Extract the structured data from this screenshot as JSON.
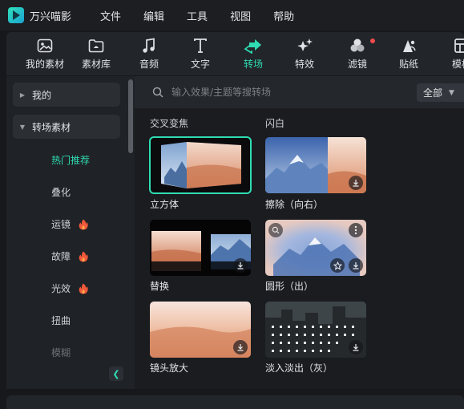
{
  "app": {
    "name": "万兴喵影"
  },
  "menu": [
    "文件",
    "编辑",
    "工具",
    "视图",
    "帮助"
  ],
  "toolbar": [
    {
      "label": "我的素材",
      "icon": "my-media-icon",
      "active": false
    },
    {
      "label": "素材库",
      "icon": "stock-media-icon",
      "active": false
    },
    {
      "label": "音频",
      "icon": "audio-icon",
      "active": false
    },
    {
      "label": "文字",
      "icon": "text-icon",
      "active": false
    },
    {
      "label": "转场",
      "icon": "transition-icon",
      "active": true
    },
    {
      "label": "特效",
      "icon": "effects-icon",
      "active": false
    },
    {
      "label": "滤镜",
      "icon": "filters-icon",
      "active": false,
      "badge": true
    },
    {
      "label": "贴纸",
      "icon": "stickers-icon",
      "active": false
    },
    {
      "label": "模板",
      "icon": "templates-icon",
      "active": false
    }
  ],
  "sidebar": {
    "groups": [
      {
        "label": "我的",
        "expanded": false
      },
      {
        "label": "转场素材",
        "expanded": true
      }
    ],
    "items": [
      {
        "label": "热门推荐",
        "active": true,
        "hot": false
      },
      {
        "label": "叠化",
        "active": false,
        "hot": false
      },
      {
        "label": "运镜",
        "active": false,
        "hot": true
      },
      {
        "label": "故障",
        "active": false,
        "hot": true
      },
      {
        "label": "光效",
        "active": false,
        "hot": true
      },
      {
        "label": "扭曲",
        "active": false,
        "hot": false
      },
      {
        "label": "模糊",
        "active": false,
        "hot": false
      }
    ],
    "collapse_icon": "chevron-left-icon"
  },
  "search": {
    "placeholder": "输入效果/主题等搜转场",
    "filter": "全部"
  },
  "content": {
    "top_labels": [
      "交叉变焦",
      "闪白"
    ],
    "cards": [
      {
        "label": "立方体",
        "selected": true
      },
      {
        "label": "擦除（向右）",
        "selected": false
      },
      {
        "label": "替换",
        "selected": false
      },
      {
        "label": "圆形（出）",
        "selected": false
      },
      {
        "label": "镜头放大",
        "selected": false
      },
      {
        "label": "淡入淡出（灰）",
        "selected": false
      }
    ]
  },
  "colors": {
    "accent": "#2fdcb3",
    "badge": "#f04b4b",
    "background": "#16181c"
  }
}
